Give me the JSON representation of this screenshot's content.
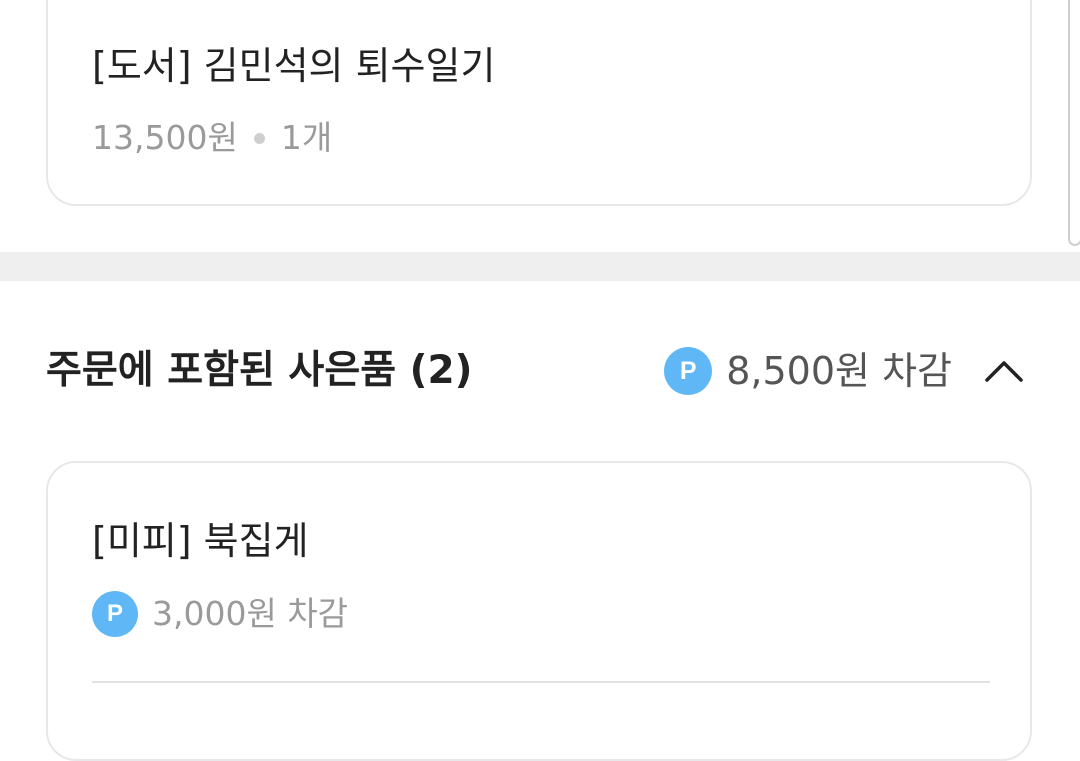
{
  "book_item": {
    "title": "[도서] 김민석의 퇴수일기",
    "price": "13,500원",
    "quantity": "1개"
  },
  "gift_section": {
    "title": "주문에 포함된 사은품 (2)",
    "point_badge": "P",
    "total_discount": "8,500원 차감",
    "toggle_icon": "chevron-up-icon",
    "badge_color": "#5fb8f5"
  },
  "gift_item": {
    "title": "[미피] 북집게",
    "point_badge": "P",
    "discount": "3,000원 차감"
  }
}
